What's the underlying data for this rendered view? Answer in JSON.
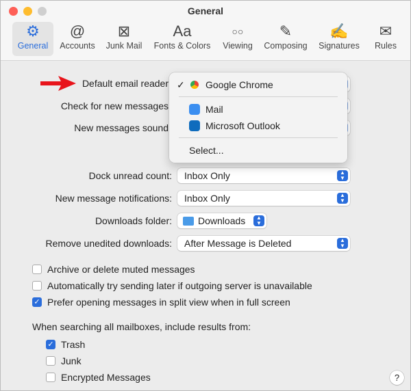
{
  "window": {
    "title": "General"
  },
  "toolbar": [
    {
      "label": "General",
      "icon": "gear-icon",
      "glyph": "⚙",
      "selected": true
    },
    {
      "label": "Accounts",
      "icon": "at-icon",
      "glyph": "@"
    },
    {
      "label": "Junk Mail",
      "icon": "junk-bin-icon",
      "glyph": "⊠"
    },
    {
      "label": "Fonts & Colors",
      "icon": "fonts-icon",
      "glyph": "Aa"
    },
    {
      "label": "Viewing",
      "icon": "glasses-icon",
      "glyph": "○○"
    },
    {
      "label": "Composing",
      "icon": "compose-icon",
      "glyph": "✎"
    },
    {
      "label": "Signatures",
      "icon": "signature-icon",
      "glyph": "✍"
    },
    {
      "label": "Rules",
      "icon": "rules-icon",
      "glyph": "✉"
    }
  ],
  "settings": {
    "default_reader": "Default email reader",
    "check_new": "Check for new messages",
    "new_sound": "New messages sound",
    "dock_label": "Dock unread count:",
    "dock_value": "Inbox Only",
    "notif_label": "New message notifications:",
    "notif_value": "Inbox Only",
    "downloads_label": "Downloads folder:",
    "downloads_value": "Downloads",
    "remove_label": "Remove unedited downloads:",
    "remove_value": "After Message is Deleted"
  },
  "menu": {
    "checkmark": "✓",
    "items": [
      "Google Chrome",
      "Mail",
      "Microsoft Outlook"
    ],
    "select": "Select..."
  },
  "checks": [
    {
      "label": "Archive or delete muted messages",
      "checked": false
    },
    {
      "label": "Automatically try sending later if outgoing server is unavailable",
      "checked": false
    },
    {
      "label": "Prefer opening messages in split view when in full screen",
      "checked": true
    }
  ],
  "search": {
    "heading": "When searching all mailboxes, include results from:",
    "items": [
      {
        "label": "Trash",
        "checked": true
      },
      {
        "label": "Junk",
        "checked": false
      },
      {
        "label": "Encrypted Messages",
        "checked": false
      }
    ]
  },
  "help": "?",
  "colors": {
    "accent": "#2a6ddb",
    "arrow": "#e8141b"
  }
}
